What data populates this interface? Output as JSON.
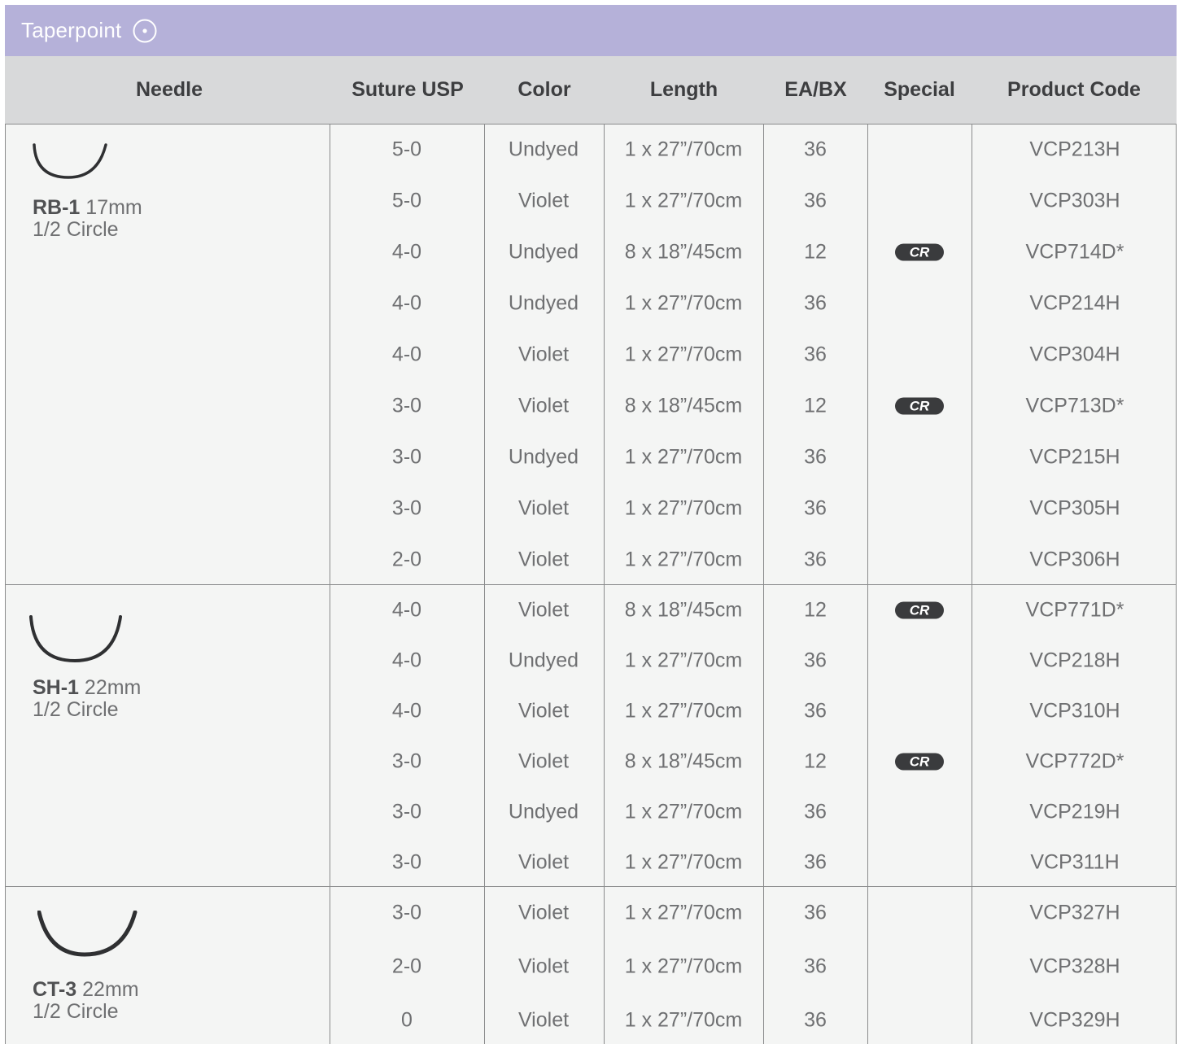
{
  "section_title": "Taperpoint",
  "headers": {
    "needle": "Needle",
    "suture_usp": "Suture USP",
    "color": "Color",
    "length": "Length",
    "ea_bx": "EA/BX",
    "special": "Special",
    "product_code": "Product Code"
  },
  "groups": [
    {
      "needle_code": "RB-1",
      "needle_size": "17mm",
      "needle_shape": "1/2 Circle",
      "rows": [
        {
          "usp": "5-0",
          "color": "Undyed",
          "length": "1 x 27”/70cm",
          "eabx": "36",
          "special": "",
          "code": "VCP213H"
        },
        {
          "usp": "5-0",
          "color": "Violet",
          "length": "1 x 27”/70cm",
          "eabx": "36",
          "special": "",
          "code": "VCP303H"
        },
        {
          "usp": "4-0",
          "color": "Undyed",
          "length": "8 x 18”/45cm",
          "eabx": "12",
          "special": "CR",
          "code": "VCP714D*"
        },
        {
          "usp": "4-0",
          "color": "Undyed",
          "length": "1 x 27”/70cm",
          "eabx": "36",
          "special": "",
          "code": "VCP214H"
        },
        {
          "usp": "4-0",
          "color": "Violet",
          "length": "1 x 27”/70cm",
          "eabx": "36",
          "special": "",
          "code": "VCP304H"
        },
        {
          "usp": "3-0",
          "color": "Violet",
          "length": "8 x 18”/45cm",
          "eabx": "12",
          "special": "CR",
          "code": "VCP713D*"
        },
        {
          "usp": "3-0",
          "color": "Undyed",
          "length": "1 x 27”/70cm",
          "eabx": "36",
          "special": "",
          "code": "VCP215H"
        },
        {
          "usp": "3-0",
          "color": "Violet",
          "length": "1 x 27”/70cm",
          "eabx": "36",
          "special": "",
          "code": "VCP305H"
        },
        {
          "usp": "2-0",
          "color": "Violet",
          "length": "1 x 27”/70cm",
          "eabx": "36",
          "special": "",
          "code": "VCP306H"
        }
      ]
    },
    {
      "needle_code": "SH-1",
      "needle_size": "22mm",
      "needle_shape": "1/2 Circle",
      "rows": [
        {
          "usp": "4-0",
          "color": "Violet",
          "length": "8 x 18”/45cm",
          "eabx": "12",
          "special": "CR",
          "code": "VCP771D*"
        },
        {
          "usp": "4-0",
          "color": "Undyed",
          "length": "1 x 27”/70cm",
          "eabx": "36",
          "special": "",
          "code": "VCP218H"
        },
        {
          "usp": "4-0",
          "color": "Violet",
          "length": "1 x 27”/70cm",
          "eabx": "36",
          "special": "",
          "code": "VCP310H"
        },
        {
          "usp": "3-0",
          "color": "Violet",
          "length": "8 x 18”/45cm",
          "eabx": "12",
          "special": "CR",
          "code": "VCP772D*"
        },
        {
          "usp": "3-0",
          "color": "Undyed",
          "length": "1 x 27”/70cm",
          "eabx": "36",
          "special": "",
          "code": "VCP219H"
        },
        {
          "usp": "3-0",
          "color": "Violet",
          "length": "1 x 27”/70cm",
          "eabx": "36",
          "special": "",
          "code": "VCP311H"
        }
      ]
    },
    {
      "needle_code": "CT-3",
      "needle_size": "22mm",
      "needle_shape": "1/2 Circle",
      "rows": [
        {
          "usp": "3-0",
          "color": "Violet",
          "length": "1 x 27”/70cm",
          "eabx": "36",
          "special": "",
          "code": "VCP327H"
        },
        {
          "usp": "2-0",
          "color": "Violet",
          "length": "1 x 27”/70cm",
          "eabx": "36",
          "special": "",
          "code": "VCP328H"
        },
        {
          "usp": "0",
          "color": "Violet",
          "length": "1 x 27”/70cm",
          "eabx": "36",
          "special": "",
          "code": "VCP329H"
        }
      ]
    }
  ],
  "colors": {
    "title_bar": "#b5b1d9",
    "header_bg": "#d8d9da",
    "body_bg": "#f4f5f4",
    "badge_bg": "#3a3b3d",
    "text": "#6f7072"
  }
}
